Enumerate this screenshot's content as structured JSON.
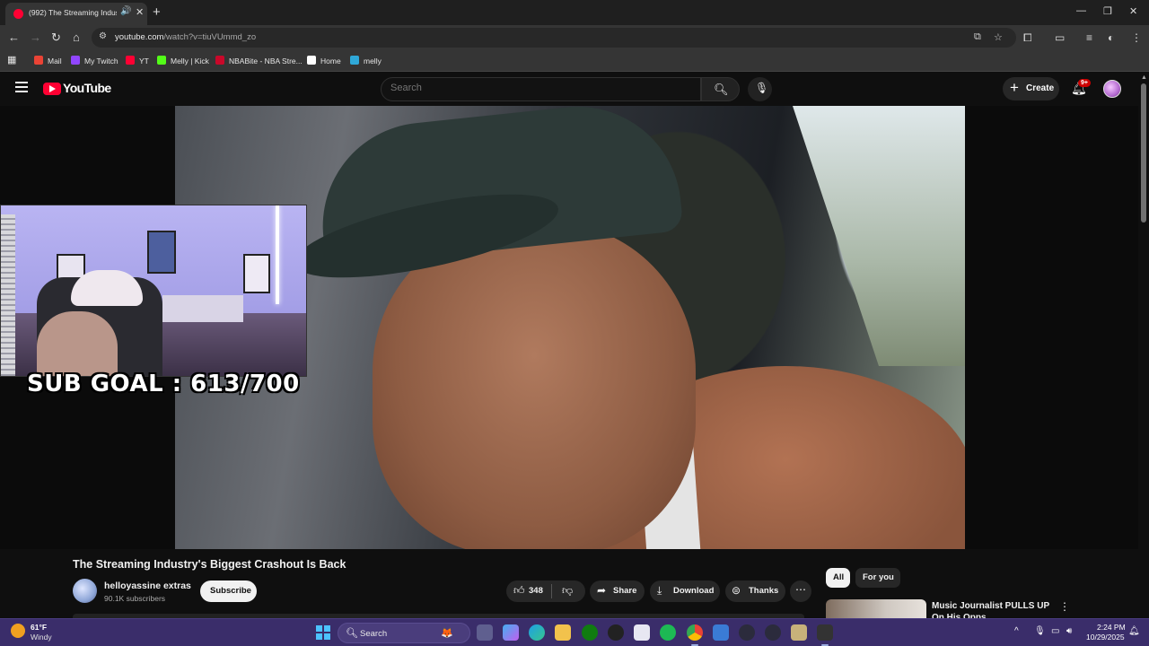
{
  "browser": {
    "tab_title": "(992) The Streaming Industr",
    "tab_audio_icon": "speaker-icon",
    "url_host": "youtube.com",
    "url_path": "/watch?v=tiuVUmmd_zo",
    "bookmarks": [
      {
        "label": "Mail",
        "icon": "gmail-icon",
        "color": "#ea4335"
      },
      {
        "label": "My Twitch",
        "icon": "twitch-icon",
        "color": "#9146ff"
      },
      {
        "label": "YT",
        "icon": "youtube-icon",
        "color": "#ff0033"
      },
      {
        "label": "Melly | Kick",
        "icon": "kick-icon",
        "color": "#53fc18"
      },
      {
        "label": "NBABite - NBA Stre...",
        "icon": "nba-icon",
        "color": "#c9082a"
      },
      {
        "label": "Home",
        "icon": "x-icon",
        "color": "#ffffff"
      },
      {
        "label": "melly",
        "icon": "bookmark-icon",
        "color": "#2fa8d8"
      }
    ]
  },
  "youtube": {
    "logo_text": "YouTube",
    "search_placeholder": "Search",
    "create_label": "Create",
    "notif_count": "9+"
  },
  "overlay": {
    "sub_goal": "SUB GOAL : 613/700"
  },
  "video": {
    "title": "The Streaming Industry's Biggest Crashout Is Back",
    "channel_name": "helloyassine extras",
    "subscribers": "90.1K subscribers",
    "subscribe_label": "Subscribe",
    "likes": "348",
    "share_label": "Share",
    "download_label": "Download",
    "thanks_label": "Thanks"
  },
  "recommendations": {
    "chips": [
      "All",
      "For you"
    ],
    "first_title": "Music Journalist PULLS UP On His Opps"
  },
  "taskbar": {
    "temperature": "61°F",
    "condition": "Windy",
    "search_label": "Search",
    "time": "2:24 PM",
    "date": "10/29/2025"
  }
}
